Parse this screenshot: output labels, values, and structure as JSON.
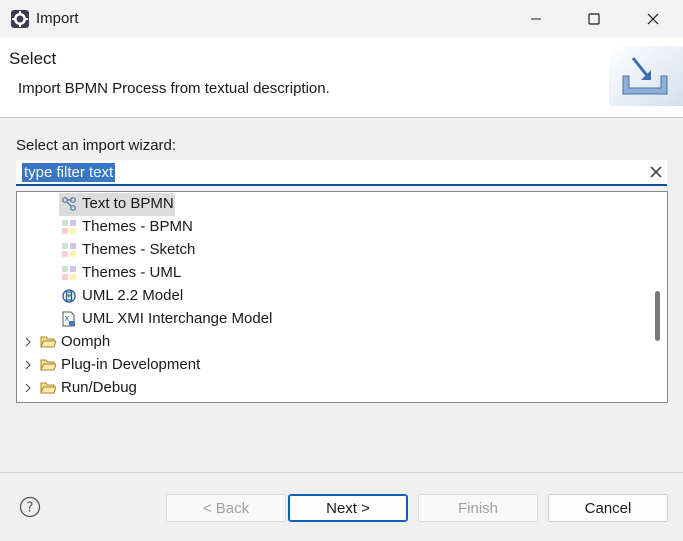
{
  "window": {
    "title": "Import",
    "icon": "eclipse-icon"
  },
  "header": {
    "title": "Select",
    "description": "Import BPMN Process from textual description.",
    "banner_icon": "import-banner-icon"
  },
  "wizard_label": "Select an import wizard:",
  "filter": {
    "value": "type filter text",
    "placeholder": "type filter text"
  },
  "tree": {
    "items": [
      {
        "label": "Text to BPMN",
        "icon": "connection-icon",
        "expandable": false,
        "selected": true
      },
      {
        "label": "Themes - BPMN",
        "icon": "theme-icon",
        "expandable": false,
        "selected": false
      },
      {
        "label": "Themes - Sketch",
        "icon": "theme-icon",
        "expandable": false,
        "selected": false
      },
      {
        "label": "Themes - UML",
        "icon": "theme-icon",
        "expandable": false,
        "selected": false
      },
      {
        "label": "UML 2.2 Model",
        "icon": "uml-model-icon",
        "expandable": false,
        "selected": false
      },
      {
        "label": "UML XMI Interchange Model",
        "icon": "xmi-file-icon",
        "expandable": false,
        "selected": false
      },
      {
        "label": "Oomph",
        "icon": "folder-icon",
        "expandable": true,
        "selected": false
      },
      {
        "label": "Plug-in Development",
        "icon": "folder-icon",
        "expandable": true,
        "selected": false
      },
      {
        "label": "Run/Debug",
        "icon": "folder-icon",
        "expandable": true,
        "selected": false
      }
    ]
  },
  "buttons": {
    "back": "< Back",
    "next": "Next >",
    "finish": "Finish",
    "cancel": "Cancel"
  },
  "colors": {
    "selection_highlight": "#3977c4",
    "focus_border": "#0d4f98",
    "default_button_border": "#0d5fb8"
  }
}
